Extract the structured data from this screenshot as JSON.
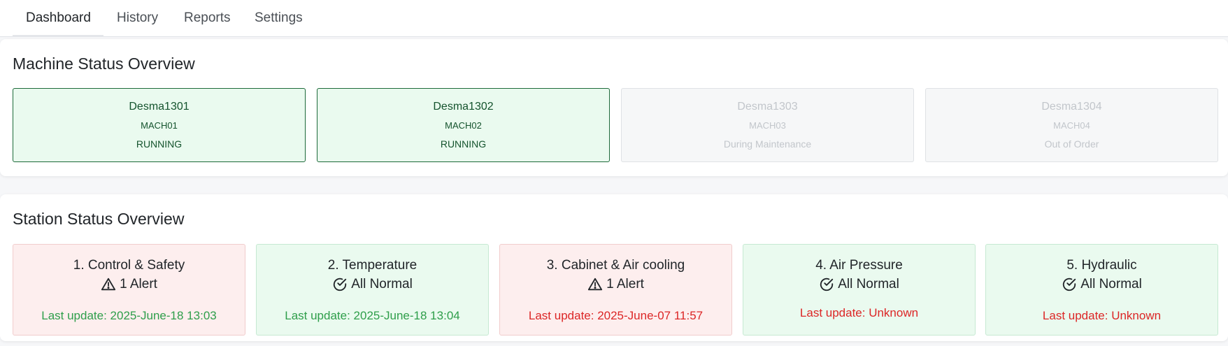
{
  "tabs": [
    {
      "label": "Dashboard",
      "active": true
    },
    {
      "label": "History",
      "active": false
    },
    {
      "label": "Reports",
      "active": false
    },
    {
      "label": "Settings",
      "active": false
    }
  ],
  "machine_overview": {
    "title": "Machine Status Overview",
    "machines": [
      {
        "name": "Desma1301",
        "code": "MACH01",
        "status": "RUNNING"
      },
      {
        "name": "Desma1302",
        "code": "MACH02",
        "status": "RUNNING"
      },
      {
        "name": "Desma1303",
        "code": "MACH03",
        "status": "During Maintenance"
      },
      {
        "name": "Desma1304",
        "code": "MACH04",
        "status": "Out of Order"
      }
    ]
  },
  "station_overview": {
    "title": "Station Status Overview",
    "stations": [
      {
        "title": "1. Control & Safety",
        "state": "1 Alert",
        "state_icon": "warning-triangle-icon",
        "last_update": "Last update: 2025-June-18 13:03"
      },
      {
        "title": "2. Temperature",
        "state": "All Normal",
        "state_icon": "check-circle-icon",
        "last_update": "Last update: 2025-June-18 13:04"
      },
      {
        "title": "3. Cabinet & Air cooling",
        "state": "1 Alert",
        "state_icon": "warning-triangle-icon",
        "last_update": "Last update: 2025-June-07 11:57"
      },
      {
        "title": "4. Air Pressure",
        "state": "All Normal",
        "state_icon": "check-circle-icon",
        "last_update": "Last update: Unknown"
      },
      {
        "title": "5. Hydraulic",
        "state": "All Normal",
        "state_icon": "check-circle-icon",
        "last_update": "Last update: Unknown"
      }
    ]
  },
  "colors": {
    "running_bg": "#eafaef",
    "running_border": "#1d6a3a",
    "alert_bg": "#fdeeee",
    "normal_bg": "#eafaef",
    "update_ok": "#2e9e4a",
    "update_stale": "#dc2626"
  }
}
